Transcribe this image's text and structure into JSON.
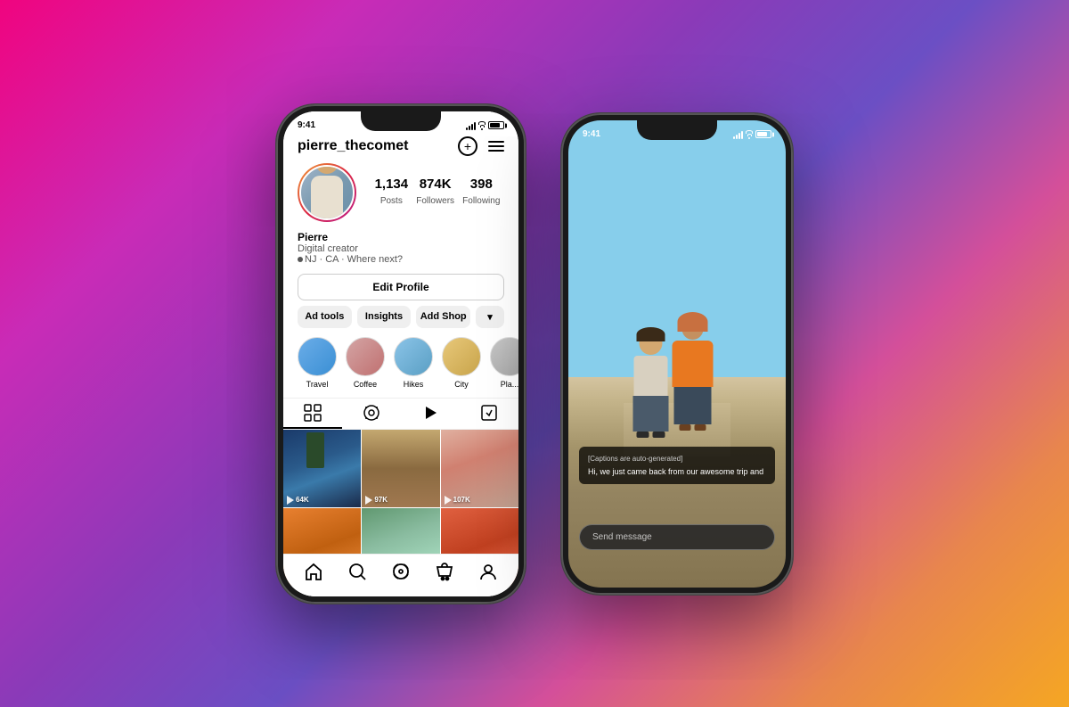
{
  "background": "gradient pink-orange-purple",
  "phone_left": {
    "status": {
      "time": "9:41",
      "signal": "full",
      "wifi": true,
      "battery": "full"
    },
    "header": {
      "username": "pierre_thecomet",
      "add_icon": "+",
      "menu_icon": "☰"
    },
    "profile": {
      "avatar_alt": "Pierre profile photo",
      "stats": [
        {
          "number": "1,134",
          "label": "Posts"
        },
        {
          "number": "874K",
          "label": "Followers"
        },
        {
          "number": "398",
          "label": "Following"
        }
      ],
      "name": "Pierre",
      "bio": "Digital creator",
      "location": "NJ · CA · Where next?"
    },
    "buttons": {
      "edit_profile": "Edit Profile",
      "ad_tools": "Ad tools",
      "insights": "Insights",
      "add_shop": "Add Shop"
    },
    "highlights": [
      {
        "label": "Travel",
        "color": "blue"
      },
      {
        "label": "Coffee",
        "color": "pink"
      },
      {
        "label": "Hikes",
        "color": "lightblue"
      },
      {
        "label": "City",
        "color": "yellow"
      },
      {
        "label": "Pla...",
        "color": "gray"
      }
    ],
    "grid_items": [
      {
        "views": "▷ 64K",
        "color": "blue-dark"
      },
      {
        "views": "▷ 97K",
        "color": "brown"
      },
      {
        "views": "▷ 107K",
        "color": "salmon"
      },
      {
        "views": "",
        "color": "orange"
      },
      {
        "views": "",
        "color": "green"
      },
      {
        "views": "",
        "color": "red"
      }
    ],
    "nav": {
      "home": "home",
      "search": "search",
      "reels": "reels",
      "shop": "shop",
      "profile": "profile"
    }
  },
  "phone_right": {
    "status": {
      "time": "9:41",
      "signal": "full",
      "wifi": true,
      "battery": "full"
    },
    "reel": {
      "caption_auto": "[Captions are auto-generated]",
      "caption_text": "Hi, we just came back from our awesome trip and",
      "send_placeholder": "Send message"
    }
  }
}
